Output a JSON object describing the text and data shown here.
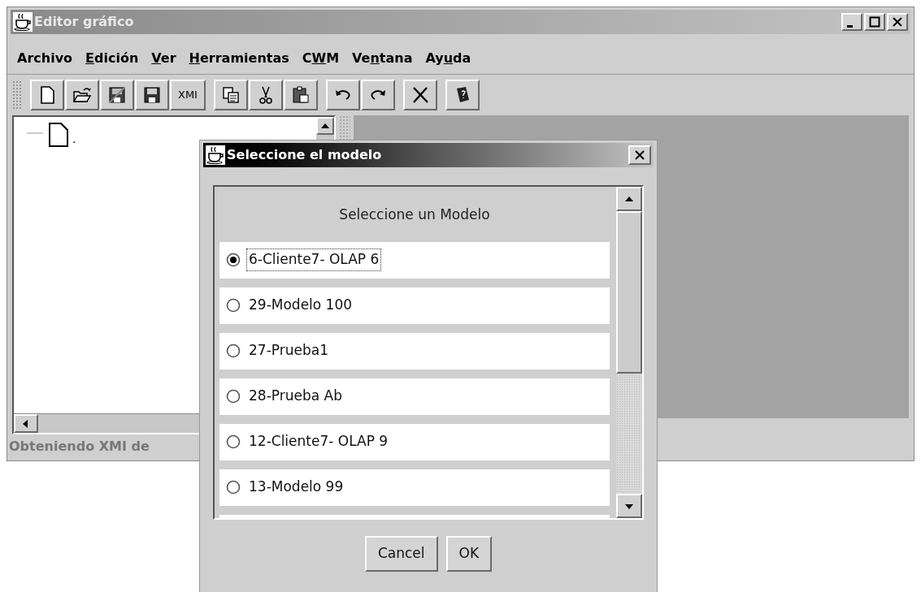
{
  "window": {
    "title": "Editor gráfico"
  },
  "menu": [
    {
      "pre": "Archivo"
    },
    {
      "key": "E",
      "post": "dición"
    },
    {
      "key": "V",
      "post": "er"
    },
    {
      "key": "H",
      "post": "erramientas"
    },
    {
      "pre": "C",
      "key": "W",
      "post": "M"
    },
    {
      "pre": "Ve",
      "key": "n",
      "post": "tana"
    },
    {
      "pre": "Ay",
      "key": "u",
      "post": "da"
    }
  ],
  "toolbar": [
    [
      {
        "kind": "new"
      },
      {
        "kind": "open"
      },
      {
        "kind": "saveas"
      },
      {
        "kind": "save"
      },
      {
        "kind": "text",
        "label": "XMI"
      }
    ],
    [
      {
        "kind": "copy"
      },
      {
        "kind": "cut"
      },
      {
        "kind": "paste"
      }
    ],
    [
      {
        "kind": "undo"
      },
      {
        "kind": "redo"
      }
    ],
    [
      {
        "kind": "delete"
      }
    ],
    [
      {
        "kind": "help"
      }
    ]
  ],
  "tree": {
    "nodes": [
      {
        "label": "."
      }
    ]
  },
  "status_bar": "Obteniendo XMI de",
  "dialog": {
    "title": "Seleccione el modelo",
    "heading": "Seleccione un Modelo",
    "options": [
      {
        "label": "6-Cliente7- OLAP 6",
        "selected": true
      },
      {
        "label": "29-Modelo 100",
        "selected": false
      },
      {
        "label": "27-Prueba1",
        "selected": false
      },
      {
        "label": "28-Prueba Ab",
        "selected": false
      },
      {
        "label": "12-Cliente7- OLAP 9",
        "selected": false
      },
      {
        "label": "13-Modelo 99",
        "selected": false
      }
    ],
    "buttons": [
      "Cancel",
      "OK"
    ]
  }
}
